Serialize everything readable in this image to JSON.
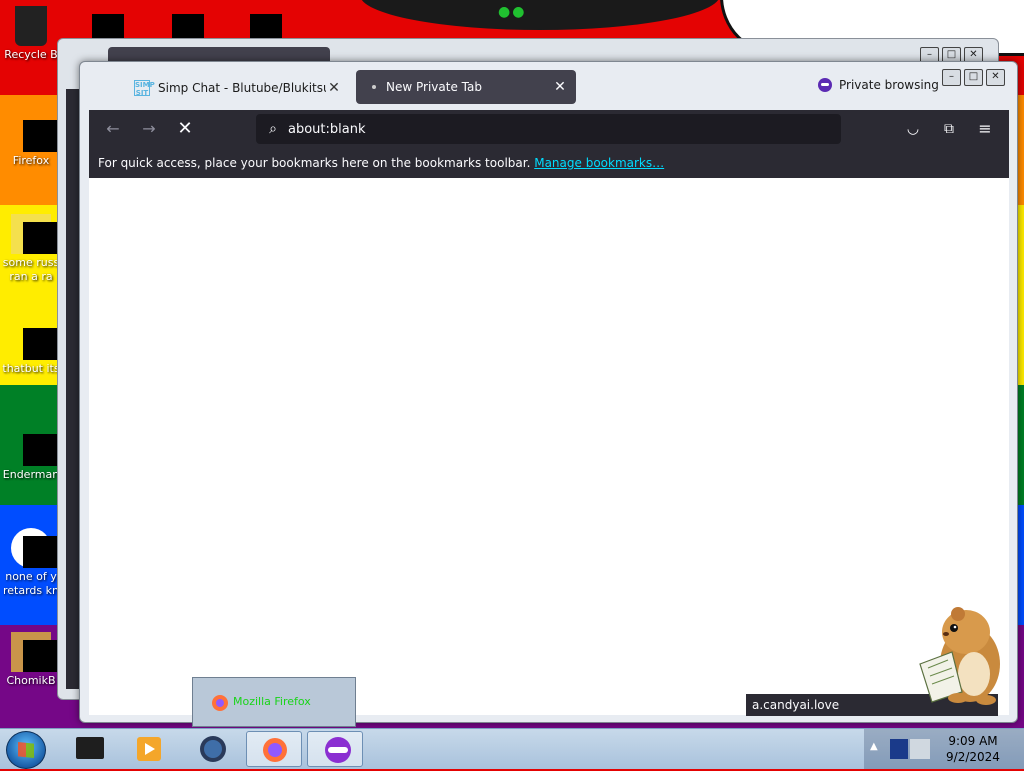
{
  "desktop": {
    "icons": [
      {
        "label": "Recycle B"
      },
      {
        "label": "Firefox"
      },
      {
        "label": "some russ ran a ra"
      },
      {
        "label": "thatbut its"
      },
      {
        "label": "Enderman"
      },
      {
        "label": "none of y retards kn"
      },
      {
        "label": "ChomikB"
      }
    ]
  },
  "browser": {
    "tabs": [
      {
        "title": "Simp Chat - Blutube/Blukitsune",
        "favicon": "SIMP SIT"
      },
      {
        "title": "New Private Tab"
      }
    ],
    "private_label": "Private browsing",
    "url": "about:blank",
    "bookmarks_text": "For quick access, place your bookmarks here on the bookmarks toolbar. ",
    "bookmarks_link": "Manage bookmarks…",
    "status_url": "a.candyai.love"
  },
  "taskbar": {
    "preview_label": "Mozilla Firefox",
    "time": "9:09 AM",
    "date": "9/2/2024"
  },
  "colors": {
    "toolbar": "#2b2a33",
    "tab_active": "#42414d",
    "link": "#00ddff",
    "private_purple": "#5b2ab3"
  }
}
